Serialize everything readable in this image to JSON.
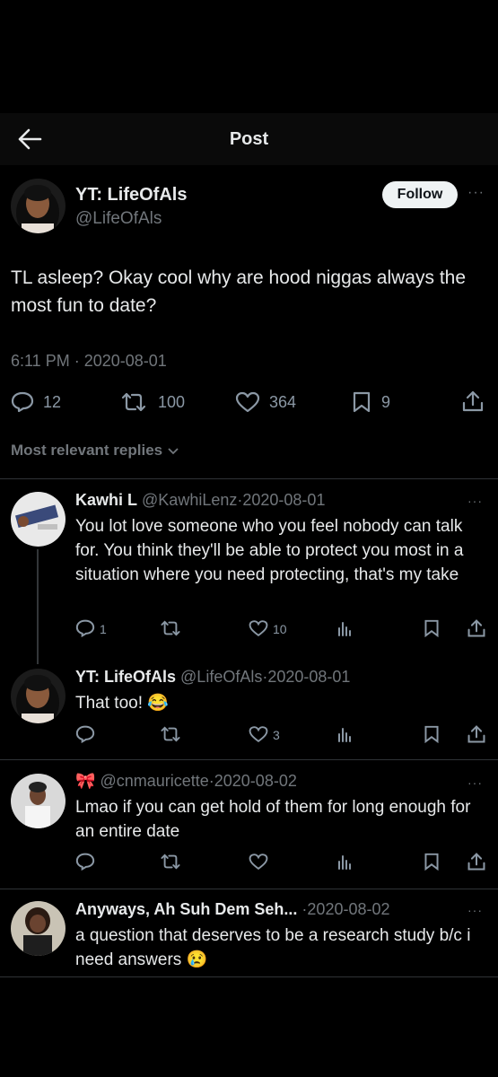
{
  "header": {
    "title": "Post"
  },
  "post": {
    "author_name": "YT: LifeOfAls",
    "author_handle": "@LifeOfAls",
    "follow_label": "Follow",
    "more": "···",
    "text": "TL asleep? Okay cool why are hood niggas always the most fun to date?",
    "time": "6:11 PM",
    "date": "2020-08-01",
    "stats": {
      "replies": "12",
      "reposts": "100",
      "likes": "364",
      "bookmarks": "9"
    }
  },
  "replies_filter": "Most relevant replies",
  "replies": [
    {
      "name": "Kawhi L",
      "handle": "@KawhiLenz",
      "date": "2020-08-01",
      "text": "You lot love someone who you feel nobody can talk for. You think they'll be able to protect you most in a situation where you need protecting, that's my take",
      "replies": "1",
      "reposts": "",
      "likes": "10"
    },
    {
      "name": "YT: LifeOfAls",
      "handle": "@LifeOfAls",
      "date": "2020-08-01",
      "text": "That too! 😂",
      "replies": "",
      "reposts": "",
      "likes": "3"
    },
    {
      "name": "🎀",
      "handle": "@cnmauricette",
      "date": "2020-08-02",
      "text": "Lmao if you can get hold of them for long enough for an entire date",
      "replies": "",
      "reposts": "",
      "likes": ""
    },
    {
      "name": "Anyways, Ah Suh Dem Seh...",
      "handle": "",
      "date": "2020-08-02",
      "text": "a question that deserves to be a research study b/c i need answers 😢",
      "replies": "",
      "reposts": "",
      "likes": ""
    }
  ],
  "separator": "·",
  "colors": {
    "background": "#000000",
    "muted": "#71767b",
    "text": "#e7e9ea"
  }
}
